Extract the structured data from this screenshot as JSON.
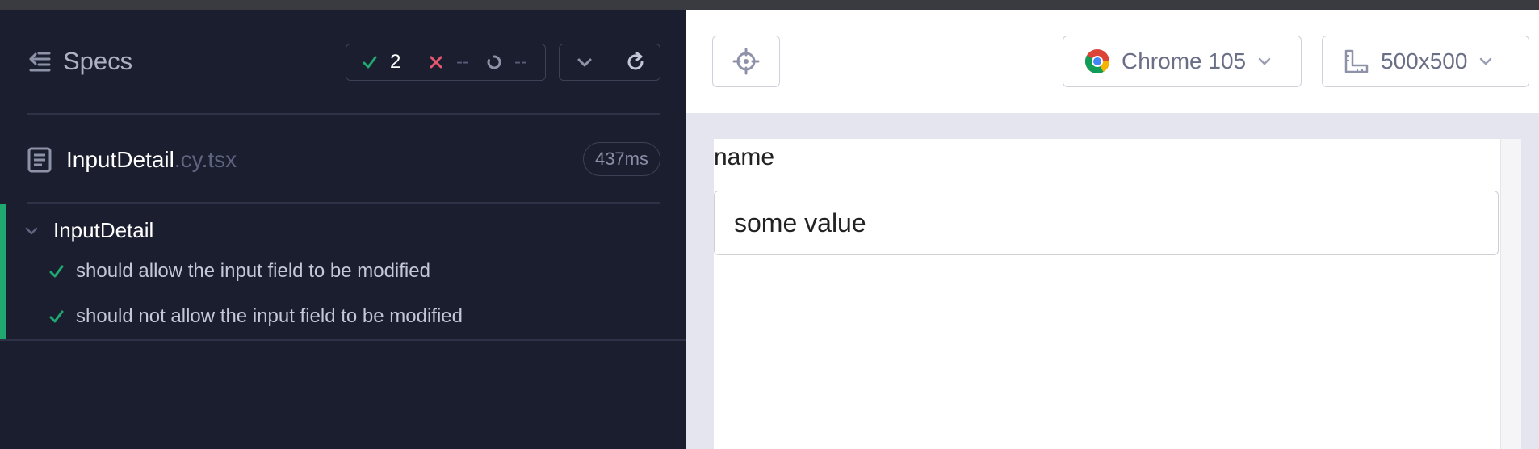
{
  "reporter": {
    "specs_label": "Specs",
    "stats": {
      "passed": "2",
      "failed": "--",
      "pending": "--"
    },
    "spec": {
      "file_name": "InputDetail",
      "file_ext": ".cy.tsx",
      "duration": "437ms"
    },
    "suite": {
      "title": "InputDetail",
      "tests": [
        {
          "label": "should allow the input field to be modified",
          "state": "passed"
        },
        {
          "label": "should not allow the input field to be modified",
          "state": "passed"
        }
      ]
    }
  },
  "app_header": {
    "browser": "Chrome 105",
    "viewport": "500x500"
  },
  "aut": {
    "field_label": "name",
    "field_value": "some value"
  },
  "colors": {
    "pass": "#1fa971",
    "fail": "#e45770",
    "reporter_bg": "#1b1e2e"
  },
  "icons": [
    "specs-list-icon",
    "check-icon",
    "x-icon",
    "pending-icon",
    "chevron-down-icon",
    "refresh-icon",
    "file-icon",
    "crosshair-icon",
    "chrome-icon",
    "ruler-icon"
  ]
}
